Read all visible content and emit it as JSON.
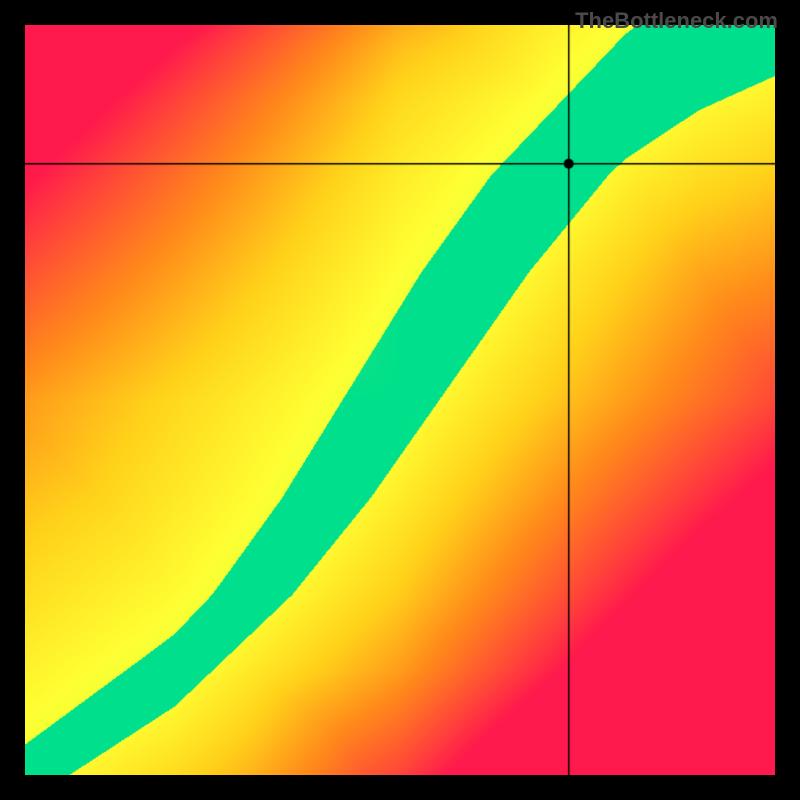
{
  "watermark": "TheBottleneck.com",
  "chart_data": {
    "type": "heatmap",
    "title": "",
    "xlabel": "",
    "ylabel": "",
    "xlim": [
      0,
      1
    ],
    "ylim": [
      0,
      1
    ],
    "grid": false,
    "crosshair": {
      "x": 0.725,
      "y": 0.815
    },
    "marker": {
      "x": 0.725,
      "y": 0.815
    },
    "color_stops": [
      {
        "value": 0.0,
        "color": "#ff1a4d"
      },
      {
        "value": 0.35,
        "color": "#ff8c1a"
      },
      {
        "value": 0.55,
        "color": "#ffd21a"
      },
      {
        "value": 0.75,
        "color": "#ffff33"
      },
      {
        "value": 0.92,
        "color": "#ccff33"
      },
      {
        "value": 1.0,
        "color": "#00e08c"
      }
    ],
    "ideal_curve_anchors": [
      {
        "x": 0.0,
        "y": 0.0
      },
      {
        "x": 0.1,
        "y": 0.07
      },
      {
        "x": 0.2,
        "y": 0.14
      },
      {
        "x": 0.3,
        "y": 0.24
      },
      {
        "x": 0.4,
        "y": 0.37
      },
      {
        "x": 0.5,
        "y": 0.52
      },
      {
        "x": 0.6,
        "y": 0.67
      },
      {
        "x": 0.7,
        "y": 0.8
      },
      {
        "x": 0.8,
        "y": 0.9
      },
      {
        "x": 0.9,
        "y": 0.97
      },
      {
        "x": 1.0,
        "y": 1.02
      }
    ],
    "band_half_width": 0.055
  }
}
